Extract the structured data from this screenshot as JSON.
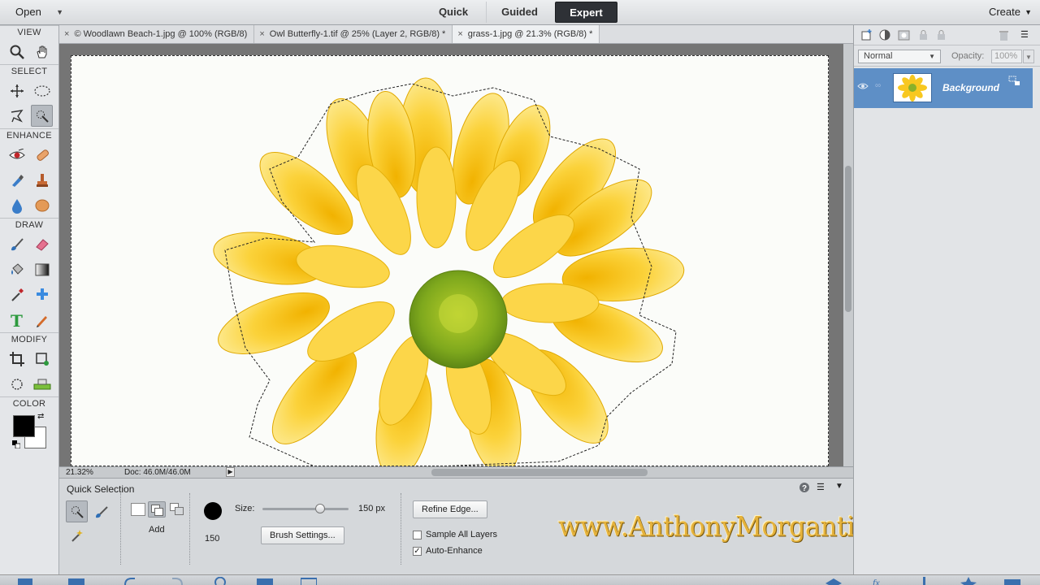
{
  "topbar": {
    "open_label": "Open",
    "modes": [
      "Quick",
      "Guided",
      "Expert"
    ],
    "active_mode": "Expert",
    "create_label": "Create"
  },
  "toolbox": {
    "sections": {
      "view": "VIEW",
      "select": "SELECT",
      "enhance": "ENHANCE",
      "draw": "DRAW",
      "modify": "MODIFY",
      "color": "COLOR"
    },
    "foreground_color": "#000000",
    "background_color": "#ffffff"
  },
  "documents": {
    "tabs": [
      "© Woodlawn Beach-1.jpg @ 100% (RGB/8)",
      "Owl Butterfly-1.tif @ 25% (Layer 2, RGB/8) *",
      "grass-1.jpg @ 21.3% (RGB/8) *"
    ],
    "active_index": 2
  },
  "status": {
    "zoom": "21.32%",
    "doc_size": "Doc: 46.0M/46.0M"
  },
  "tool_options": {
    "title": "Quick Selection",
    "mode_label": "Add",
    "brush_size_preview": "150",
    "size_label": "Size:",
    "size_value": "150 px",
    "size_fraction": 0.67,
    "brush_settings_label": "Brush Settings...",
    "refine_edge_label": "Refine Edge...",
    "sample_all_layers_label": "Sample All Layers",
    "sample_all_layers_checked": false,
    "auto_enhance_label": "Auto-Enhance",
    "auto_enhance_checked": true,
    "watermark": "www.AnthonyMorganti.com"
  },
  "layers": {
    "blend_mode": "Normal",
    "opacity_label": "Opacity:",
    "opacity_value": "100%",
    "layer_name": "Background",
    "selected_color": "#5e8fc6"
  }
}
